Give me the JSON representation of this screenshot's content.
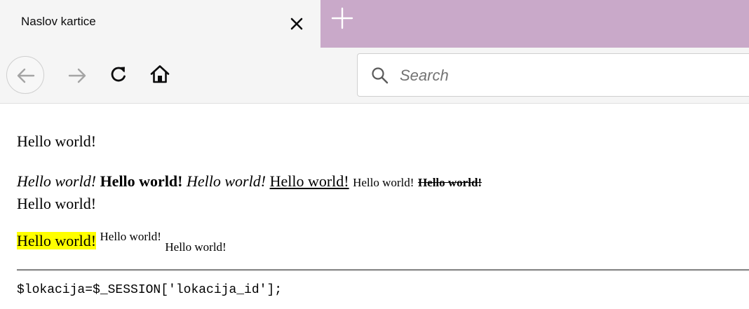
{
  "browser": {
    "tab_title": "Naslov kartice",
    "search_placeholder": "Search"
  },
  "page": {
    "paragraph1": "Hello world!",
    "line2": {
      "italic1": "Hello world!",
      "bold": "Hello world!",
      "italic2": "Hello world!",
      "underline": "Hello world!",
      "small": "Hello world!",
      "strike": "Hello world!"
    },
    "line3": "Hello world!",
    "line4": {
      "mark": "Hello world!",
      "sup": "Hello world!",
      "sub": "Hello world!"
    },
    "code": "$lokacija=$_SESSION['lokacija_id'];"
  },
  "colors": {
    "tabstrip": "#c9a9c9",
    "highlight": "#ffff00"
  }
}
